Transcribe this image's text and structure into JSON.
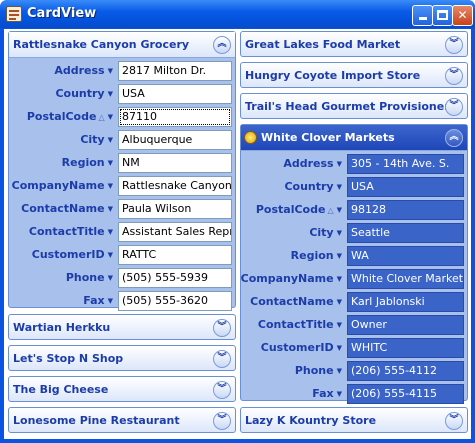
{
  "window": {
    "title": "CardView",
    "minimize_icon": "minimize-icon",
    "maximize_icon": "maximize-icon",
    "close_icon": "close-icon"
  },
  "fields": [
    "Address",
    "Country",
    "PostalCode",
    "City",
    "Region",
    "CompanyName",
    "ContactName",
    "ContactTitle",
    "CustomerID",
    "Phone",
    "Fax"
  ],
  "cards": {
    "rattlesnake": {
      "title": "Rattlesnake Canyon Grocery",
      "values": [
        "2817 Milton Dr.",
        "USA",
        "87110",
        "Albuquerque",
        "NM",
        "Rattlesnake Canyon",
        "Paula Wilson",
        "Assistant Sales Repre",
        "RATTC",
        "(505) 555-5939",
        "(505) 555-3620"
      ]
    },
    "whiteclover": {
      "title": "White Clover Markets",
      "values": [
        "305 - 14th Ave. S.",
        "USA",
        "98128",
        "Seattle",
        "WA",
        "White Clover Markets",
        "Karl Jablonski",
        "Owner",
        "WHITC",
        "(206) 555-4112",
        "(206) 555-4115"
      ]
    },
    "collapsed_left": [
      "Wartian Herkku",
      "Let's Stop N Shop",
      "The Big Cheese",
      "Lonesome Pine Restaurant"
    ],
    "collapsed_right_top": [
      "Great Lakes Food Market",
      "Hungry Coyote Import Store",
      "Trail's Head Gourmet Provisioners"
    ],
    "collapsed_right_bottom": [
      "Lazy K Kountry Store"
    ]
  },
  "colors": {
    "title_bar": "#0a5ce8",
    "card_title": "#1c3caa",
    "focused_card_header": "#2c54c0"
  }
}
